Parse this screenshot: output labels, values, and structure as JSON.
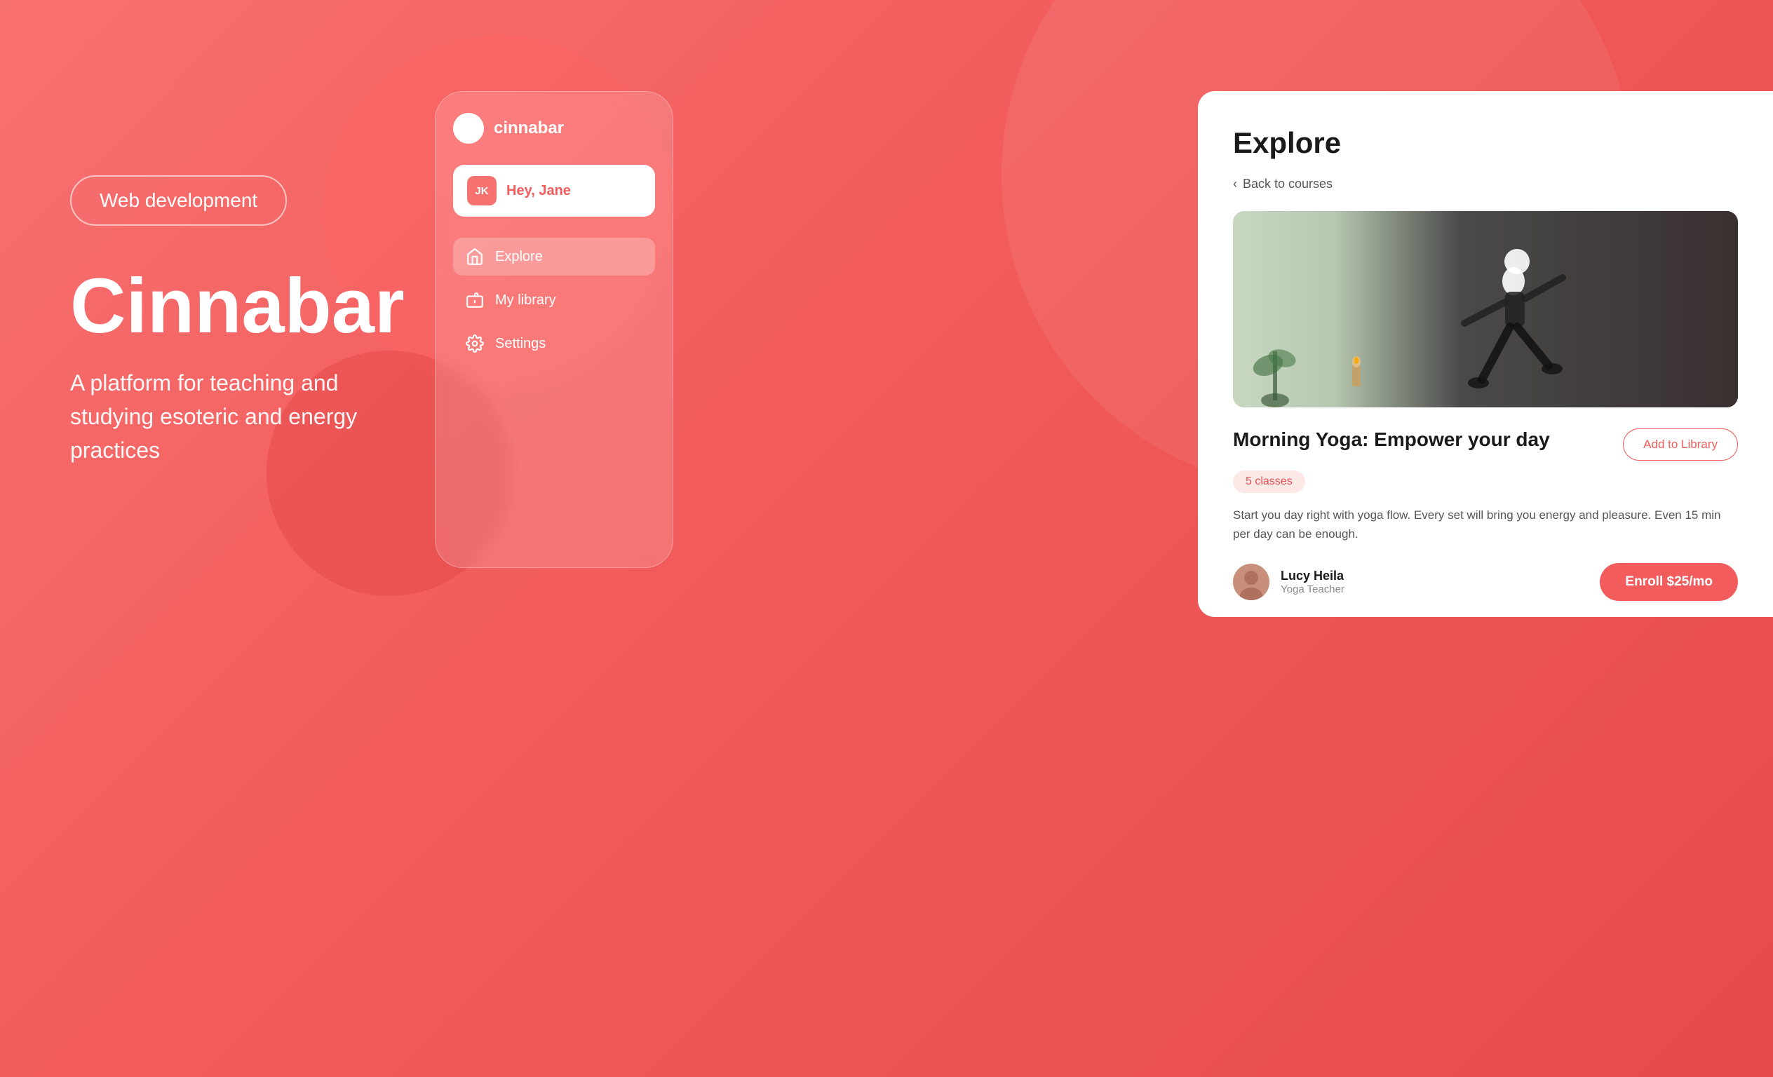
{
  "background": {
    "gradient_start": "#f87171",
    "gradient_end": "#e84a4a"
  },
  "left": {
    "badge_label": "Web development",
    "brand_name": "Cinnabar",
    "subtitle": "A platform for teaching and studying esoteric and energy practices"
  },
  "mobile_app": {
    "app_name": "cinnabar",
    "user_initials": "JK",
    "greeting": "Hey, Jane",
    "nav_items": [
      {
        "label": "Explore",
        "icon": "home-icon",
        "active": true
      },
      {
        "label": "My library",
        "icon": "library-icon",
        "active": false
      },
      {
        "label": "Settings",
        "icon": "settings-icon",
        "active": false
      }
    ]
  },
  "desktop_panel": {
    "title": "Explore",
    "back_link": "Back to courses",
    "course": {
      "title": "Morning Yoga: Empower your day",
      "classes_count": "5 classes",
      "description": "Start you day right with yoga flow. Every set will bring you energy and pleasure. Even 15 min per day can be enough.",
      "add_library_label": "Add to Library",
      "enroll_label": "Enroll $25/mo",
      "instructor_name": "Lucy Heila",
      "instructor_title": "Yoga Teacher"
    }
  }
}
